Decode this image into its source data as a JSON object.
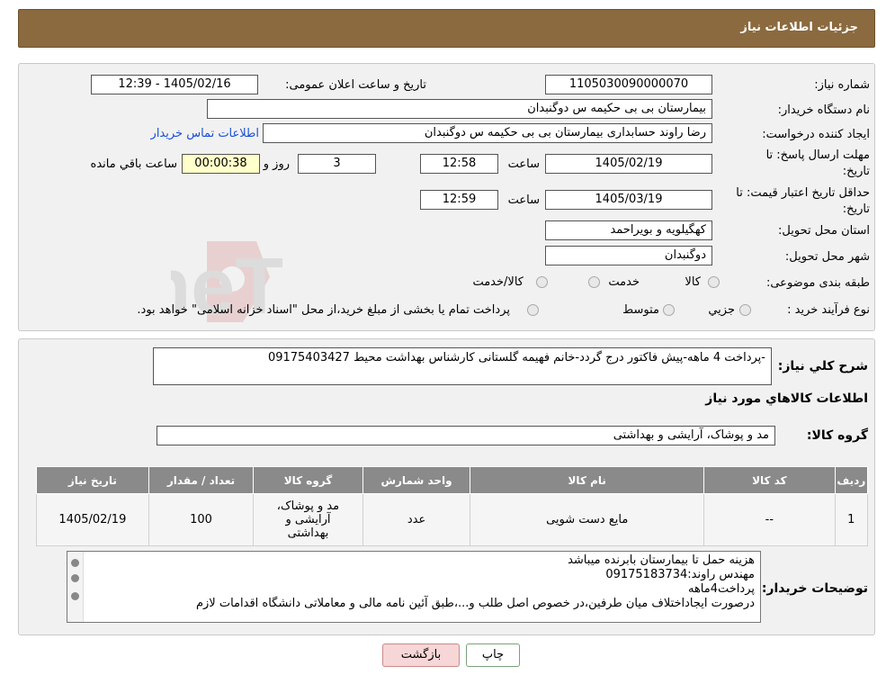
{
  "header": {
    "title": "جزئیات اطلاعات نیاز"
  },
  "form": {
    "need_number_label": "شماره نیاز:",
    "need_number": "1105030090000070",
    "announce_label": "تاریخ و ساعت اعلان عمومی:",
    "announce_value": "1405/02/16 - 12:39",
    "buyer_org_label": "نام دستگاه خریدار:",
    "buyer_org": "بیمارستان بی بی حکیمه س  دوگنبدان",
    "creator_label": "ایجاد کننده درخواست:",
    "creator": "رضا راوند حسابداری بیمارستان بی بی حکیمه س  دوگنبدان",
    "contact_link": "اطلاعات تماس خریدار",
    "deadline_label_1": "مهلت ارسال پاسخ: تا",
    "deadline_label_2": "تاریخ:",
    "deadline_date": "1405/02/19",
    "time_label": "ساعت",
    "deadline_time": "12:58",
    "days_value": "3",
    "days_label": "روز و",
    "remaining_time": "00:00:38",
    "remaining_label": "ساعت باقي مانده",
    "validity_label_1": "حداقل تاریخ اعتبار قیمت: تا",
    "validity_label_2": "تاریخ:",
    "validity_date": "1405/03/19",
    "validity_time": "12:59",
    "province_label": "استان محل تحویل:",
    "province": "کهگیلویه و بویراحمد",
    "city_label": "شهر محل تحویل:",
    "city": "دوگنبدان",
    "category_label": "طبقه بندی موضوعی:",
    "category_options": [
      "کالا",
      "خدمت",
      "کالا/خدمت"
    ],
    "process_label": "نوع فرآیند خرید :",
    "process_options": [
      "جزيي",
      "متوسط"
    ],
    "process_note": "پرداخت تمام یا بخشی از مبلغ خرید،از محل \"اسناد خزانه اسلامی\" خواهد بود."
  },
  "summary": {
    "label": "شرح کلي نياز:",
    "text": "-پرداخت 4 ماهه-پیش فاکتور درج گردد-خانم فهیمه گلستانی کارشناس بهداشت محیط 09175403427",
    "goods_info_title": "اطلاعات کالاهاي مورد نياز",
    "group_label": "گروه کالا:",
    "group_value": "مد و پوشاک، آرایشی و بهداشتی"
  },
  "table": {
    "headers": [
      "رديف",
      "کد کالا",
      "نام کالا",
      "واحد شمارش",
      "گروه کالا",
      "تعداد / مقدار",
      "تاريخ نياز"
    ],
    "rows": [
      {
        "row": "1",
        "code": "--",
        "name": "مایع دست شویی",
        "unit": "عدد",
        "group": "مد و پوشاک، آرایشی و بهداشتی",
        "qty": "100",
        "date": "1405/02/19"
      }
    ]
  },
  "notes": {
    "label": "توضیحات خریدار:",
    "lines": [
      "هزینه حمل تا بیمارستان بابرنده میباشد",
      "مهندس راوند:09175183734",
      "پرداخت4ماهه",
      "درصورت ایجاداختلاف میان طرفین،در خصوص اصل طلب و...،طبق آئین نامه مالی و معاملاتی دانشگاه اقدامات لازم"
    ]
  },
  "buttons": {
    "print": "چاپ",
    "back": "بازگشت"
  },
  "watermark": {
    "text": "AriaTender.neT"
  },
  "colors": {
    "header": "#8b6a3f",
    "table_header": "#8a8a8a",
    "back_button": "#f6d6d6"
  }
}
